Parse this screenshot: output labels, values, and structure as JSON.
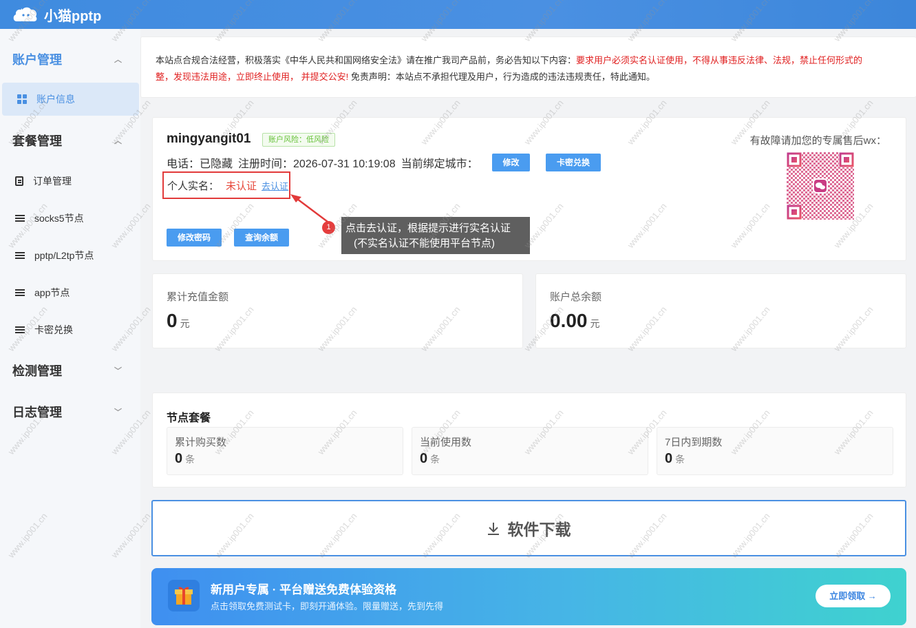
{
  "header": {
    "app_name": "小猫pptp"
  },
  "sidebar": {
    "groups": [
      {
        "label": "账户管理",
        "chevron": "^"
      },
      {
        "label": "套餐管理",
        "chevron": "^"
      },
      {
        "label": "检测管理",
        "chevron": "v"
      },
      {
        "label": "日志管理",
        "chevron": "v"
      }
    ],
    "items": [
      {
        "label": "账户信息",
        "icon": "grid-icon"
      },
      {
        "label": "订单管理",
        "icon": "order-icon"
      },
      {
        "label": "socks5节点",
        "icon": "list-icon"
      },
      {
        "label": "pptp/L2tp节点",
        "icon": "list-icon"
      },
      {
        "label": "app节点",
        "icon": "list-icon"
      },
      {
        "label": "卡密兑换",
        "icon": "list-icon"
      }
    ]
  },
  "notice": {
    "part1": "本站点合规合法经营，积极落实《中华人民共和国网络安全法》请在推广我司产品前，务必告知以下内容：",
    "part2_red": "要求用户必须实名认证使用，不得从事违反法律、法规，禁止任何形式的",
    "part3_red": "整，发现违法用途，立即终止使用， 并提交公安!",
    "part4": " 免责声明：本站点不承担代理及用户，行为造成的违法违规责任，特此通知。"
  },
  "account": {
    "username": "mingyangit01",
    "risk_badge": "账户风险：低风险",
    "phone": "电话：已隐藏",
    "register_time": "注册时间：2026-07-31 10:19:08",
    "bound_city": "当前绑定城市：",
    "modify_button": "修改",
    "card_redeem_button": "卡密兑换",
    "realname_label": "个人实名：",
    "realname_status": "未认证",
    "realname_link": "去认证",
    "change_password_button": "修改密码",
    "query_balance_button": "查询余额",
    "qr_title": "有故障请加您的专属售后wx："
  },
  "tooltip": {
    "step": "1",
    "line1": "点击去认证，根据提示进行实名认证",
    "line2": "(不实名认证不能使用平台节点)"
  },
  "stats": [
    {
      "label": "累计充值金额",
      "value": "0",
      "unit": "元"
    },
    {
      "label": "账户总余额",
      "value": "0.00",
      "unit": "元"
    }
  ],
  "package": {
    "title": "节点套餐",
    "items": [
      {
        "label": "累计购买数",
        "value": "0",
        "unit": "条"
      },
      {
        "label": "当前使用数",
        "value": "0",
        "unit": "条"
      },
      {
        "label": "7日内到期数",
        "value": "0",
        "unit": "条"
      }
    ]
  },
  "download": {
    "label": "软件下载"
  },
  "promo": {
    "title": "新用户专属 · 平台赠送免费体验资格",
    "subtitle": "点击领取免费测试卡，即刻开通体验。限量赠送，先到先得",
    "button": "立即领取 →"
  },
  "watermark": {
    "text": "www.ip001.cn"
  },
  "colors": {
    "primary": "#4a90e2",
    "danger": "#e02020",
    "success": "#67c23a"
  }
}
